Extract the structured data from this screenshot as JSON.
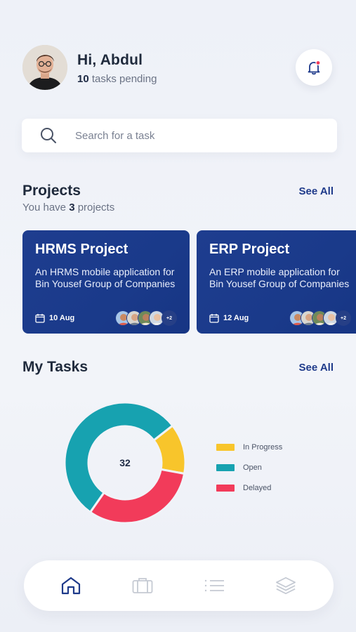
{
  "header": {
    "greeting": "Hi, Abdul",
    "pending_count": "10",
    "pending_text": " tasks pending"
  },
  "search": {
    "placeholder": "Search for a task",
    "value": ""
  },
  "projects": {
    "title": "Projects",
    "see_all": "See All",
    "sub_prefix": "You have ",
    "count": "3",
    "sub_suffix": " projects",
    "cards": [
      {
        "name": "HRMS Project",
        "description": "An HRMS mobile application for Bin Yousef Group of Companies",
        "date": "10 Aug",
        "more": "+2"
      },
      {
        "name": "ERP Project",
        "description": "An ERP mobile application for Bin Yousef Group of Companies",
        "date": "12 Aug",
        "more": "+2"
      }
    ]
  },
  "tasks": {
    "title": "My Tasks",
    "see_all": "See All",
    "total": "32"
  },
  "colors": {
    "primary": "#1e3a8a",
    "in_progress": "#f8c52b",
    "open": "#17a2b0",
    "delayed": "#f23b5a"
  },
  "chart_data": {
    "type": "pie",
    "donut": true,
    "center_label": "32",
    "legend_position": "right",
    "series": [
      {
        "name": "In Progress",
        "value": 4.3,
        "color": "#f8c52b"
      },
      {
        "name": "Delayed",
        "value": 10.2,
        "color": "#f23b5a"
      },
      {
        "name": "Open",
        "value": 17.5,
        "color": "#17a2b0"
      }
    ],
    "start_angle_deg": -38
  },
  "nav": {
    "items": [
      "home-icon",
      "briefcase-icon",
      "list-icon",
      "layers-icon"
    ],
    "active": "home-icon"
  }
}
